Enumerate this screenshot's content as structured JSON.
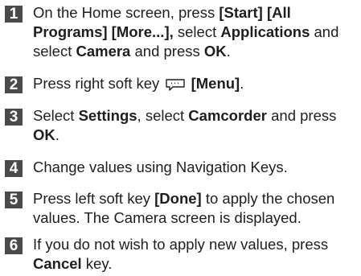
{
  "steps": [
    {
      "number": "1",
      "segments": [
        {
          "text": "On the Home screen, press ",
          "bold": false
        },
        {
          "text": "[Start] [All Programs] [More...],",
          "bold": true
        },
        {
          "text": " select ",
          "bold": false
        },
        {
          "text": "Applications",
          "bold": true
        },
        {
          "text": " and select ",
          "bold": false
        },
        {
          "text": "Camera",
          "bold": true
        },
        {
          "text": " and press ",
          "bold": false
        },
        {
          "text": "OK",
          "bold": true
        },
        {
          "text": ".",
          "bold": false
        }
      ]
    },
    {
      "number": "2",
      "segments": [
        {
          "text": "Press right soft key ",
          "bold": false
        },
        {
          "icon": "menu-softkey-icon"
        },
        {
          "text": " [Menu]",
          "bold": true
        },
        {
          "text": ".",
          "bold": false
        }
      ]
    },
    {
      "number": "3",
      "segments": [
        {
          "text": "Select ",
          "bold": false
        },
        {
          "text": "Settings",
          "bold": true
        },
        {
          "text": ", select ",
          "bold": false
        },
        {
          "text": "Camcorder",
          "bold": true
        },
        {
          "text": " and press ",
          "bold": false
        },
        {
          "text": "OK",
          "bold": true
        },
        {
          "text": ".",
          "bold": false
        }
      ]
    },
    {
      "number": "4",
      "segments": [
        {
          "text": "Change values using Navigation Keys.",
          "bold": false
        }
      ]
    },
    {
      "number": "5",
      "segments": [
        {
          "text": "Press left soft key ",
          "bold": false
        },
        {
          "text": "[Done]",
          "bold": true
        },
        {
          "text": " to apply the chosen values. The Camera screen is displayed.",
          "bold": false
        }
      ]
    },
    {
      "number": "6",
      "segments": [
        {
          "text": "If you do not wish to apply new values, press ",
          "bold": false
        },
        {
          "text": "Cancel",
          "bold": true
        },
        {
          "text": " key.",
          "bold": false
        }
      ]
    }
  ]
}
